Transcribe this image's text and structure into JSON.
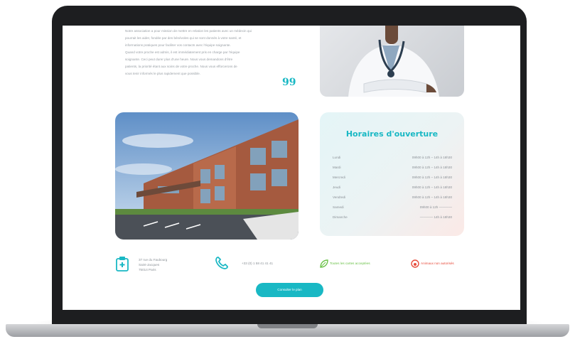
{
  "quote": {
    "lines": [
      "Notre association a pour mission de mettre en relation les patients avec un médecin qui",
      "pourrait les aider, fondée par des bénévoles qui se sont donnés à votre santé, et",
      "informations pratiques pour faciliter vos contacts avec l'équipe soignante.",
      "Quand votre proche est admis, il est immédiatement pris en charge par l'équipe",
      "soignante. Ceci peut durer plus d'une heure. Nous vous demandons d'être",
      "patients, la priorité étant aux soins de votre proche. Nous vous efforcerons de",
      "vous tenir informés le plus rapidement que possible."
    ],
    "mark": "99"
  },
  "hours": {
    "title": "Horaires d'ouverture",
    "rows": [
      {
        "day": "Lundi",
        "time": "09h00 à 12h – 14h à 18h30"
      },
      {
        "day": "Mardi",
        "time": "09h00 à 12h – 14h à 18h30"
      },
      {
        "day": "Mercredi",
        "time": "09h00 à 12h – 14h à 18h30"
      },
      {
        "day": "Jeudi",
        "time": "09h00 à 12h – 14h à 18h30"
      },
      {
        "day": "Vendredi",
        "time": "09h00 à 12h – 14h à 18h30"
      },
      {
        "day": "Samedi",
        "time": "09h00 à 12h ————"
      },
      {
        "day": "Dimanche",
        "time": "———— 14h à 18h30"
      }
    ]
  },
  "contact": {
    "address": [
      "37 rue du Faubourg",
      "Saint-Jacques",
      "75014 Paris"
    ],
    "phone": "+33 (0) 1 58 41 41 41",
    "accepted": "Toutes les cartes acceptées",
    "pets": "Animaux non autorisés"
  },
  "cta": {
    "label": "Consulter le plan"
  },
  "colors": {
    "accent": "#19b8c4",
    "green": "#6cc24a",
    "red": "#e74c3c",
    "frame": "#1d1e20"
  },
  "icons": [
    "hospital-icon",
    "phone-icon",
    "leaf-icon",
    "pet-forbidden-icon",
    "quote-icon"
  ]
}
